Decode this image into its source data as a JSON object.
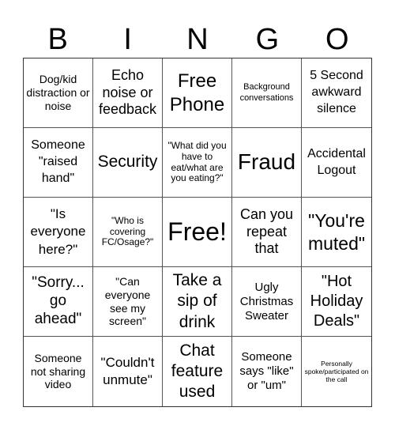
{
  "header": {
    "letters": [
      "B",
      "I",
      "N",
      "G",
      "O"
    ]
  },
  "grid": {
    "rows": [
      [
        "Dog/kid distraction or noise",
        "Echo noise or feedback",
        "Free Phone",
        "Background conversations",
        "5 Second awkward silence"
      ],
      [
        "Someone \"raised hand\"",
        "Security",
        "\"What did you have to eat/what are you eating?\"",
        "Fraud",
        "Accidental Logout"
      ],
      [
        "\"Is everyone here?\"",
        "\"Who is covering FC/Osage?\"",
        "Free!",
        "Can you repeat that",
        "\"You're muted\""
      ],
      [
        "\"Sorry... go ahead\"",
        "\"Can everyone see my screen\"",
        "Take a sip of drink",
        "Ugly Christmas Sweater",
        "\"Hot Holiday Deals\""
      ],
      [
        "Someone not sharing video",
        "\"Couldn't unmute\"",
        "Chat feature used",
        "Someone says \"like\" or \"um\"",
        "Personally spoke/participated on the call"
      ]
    ]
  }
}
